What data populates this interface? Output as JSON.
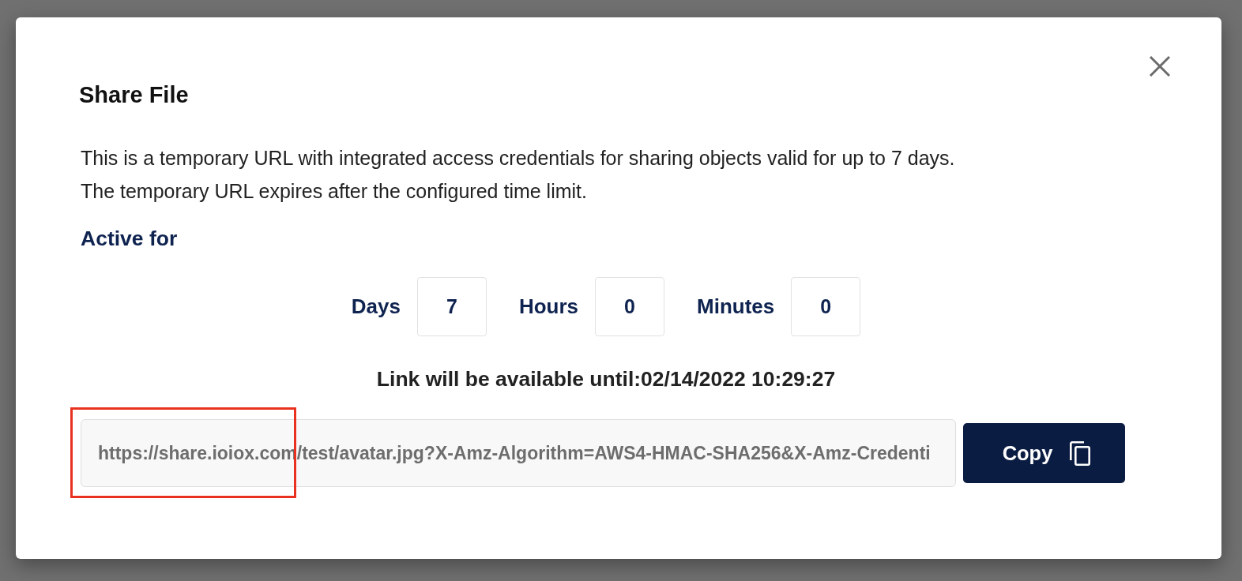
{
  "dialog": {
    "title": "Share File",
    "description": [
      "This is a temporary URL with integrated access credentials for sharing objects valid for up to 7 days.",
      "The temporary URL expires after the configured time limit."
    ],
    "duration": {
      "heading": "Active for",
      "fields": [
        {
          "label": "Days",
          "value": "7"
        },
        {
          "label": "Hours",
          "value": "0"
        },
        {
          "label": "Minutes",
          "value": "0"
        }
      ]
    },
    "expiry_note": "Link will be available until:02/14/2022 10:29:27",
    "share_link": {
      "value": "https://share.ioiox.com/test/avatar.jpg?X-Amz-Algorithm=AWS4-HMAC-SHA256&X-Amz-Credenti",
      "button": "Copy"
    }
  },
  "annotations": [
    {
      "kind": "highlight-box"
    }
  ]
}
